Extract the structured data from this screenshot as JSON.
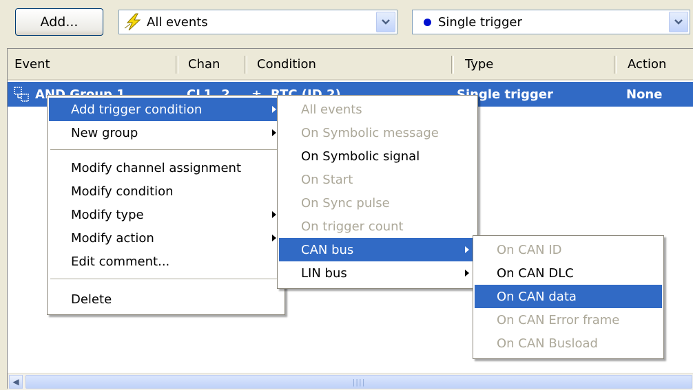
{
  "toolbar": {
    "add_label": "Add...",
    "event_filter": "All events",
    "trigger_mode": "Single trigger"
  },
  "table": {
    "columns": [
      "Event",
      "Chan",
      "Condition",
      "Type",
      "Action"
    ],
    "row": {
      "event": "AND Group 1",
      "chan": "CL1, 2",
      "condition": "RTC (ID 2)",
      "type": "Single trigger",
      "action": "None"
    },
    "scroll_grip": "||||"
  },
  "context_menu": {
    "items": [
      {
        "label": "Add trigger condition",
        "submenu": true,
        "highlighted": true
      },
      {
        "label": "New group",
        "submenu": true
      },
      {
        "label": "Modify channel assignment"
      },
      {
        "label": "Modify condition"
      },
      {
        "label": "Modify type",
        "submenu": true
      },
      {
        "label": "Modify action",
        "submenu": true
      },
      {
        "label": "Edit comment..."
      },
      {
        "label": "Delete"
      }
    ]
  },
  "trigger_submenu": {
    "items": [
      {
        "label": "All events",
        "disabled": true
      },
      {
        "label": "On Symbolic message",
        "disabled": true
      },
      {
        "label": "On Symbolic signal"
      },
      {
        "label": "On Start",
        "disabled": true
      },
      {
        "label": "On Sync pulse",
        "disabled": true
      },
      {
        "label": "On trigger count",
        "disabled": true
      },
      {
        "label": "CAN bus",
        "submenu": true,
        "highlighted": true
      },
      {
        "label": "LIN bus",
        "submenu": true
      }
    ]
  },
  "can_submenu": {
    "items": [
      {
        "label": "On CAN ID",
        "disabled": true
      },
      {
        "label": "On CAN DLC"
      },
      {
        "label": "On CAN data",
        "highlighted": true
      },
      {
        "label": "On CAN Error frame",
        "disabled": true
      },
      {
        "label": "On CAN Busload",
        "disabled": true
      }
    ]
  },
  "colors": {
    "selection": "#316ac5",
    "disabled_text": "#aca899",
    "window_bg": "#ece9d8"
  },
  "icons": {
    "event_filter": "lightning-bolt-icon",
    "trigger_mode": "blue-dot-icon",
    "row": "and-group-icon"
  }
}
